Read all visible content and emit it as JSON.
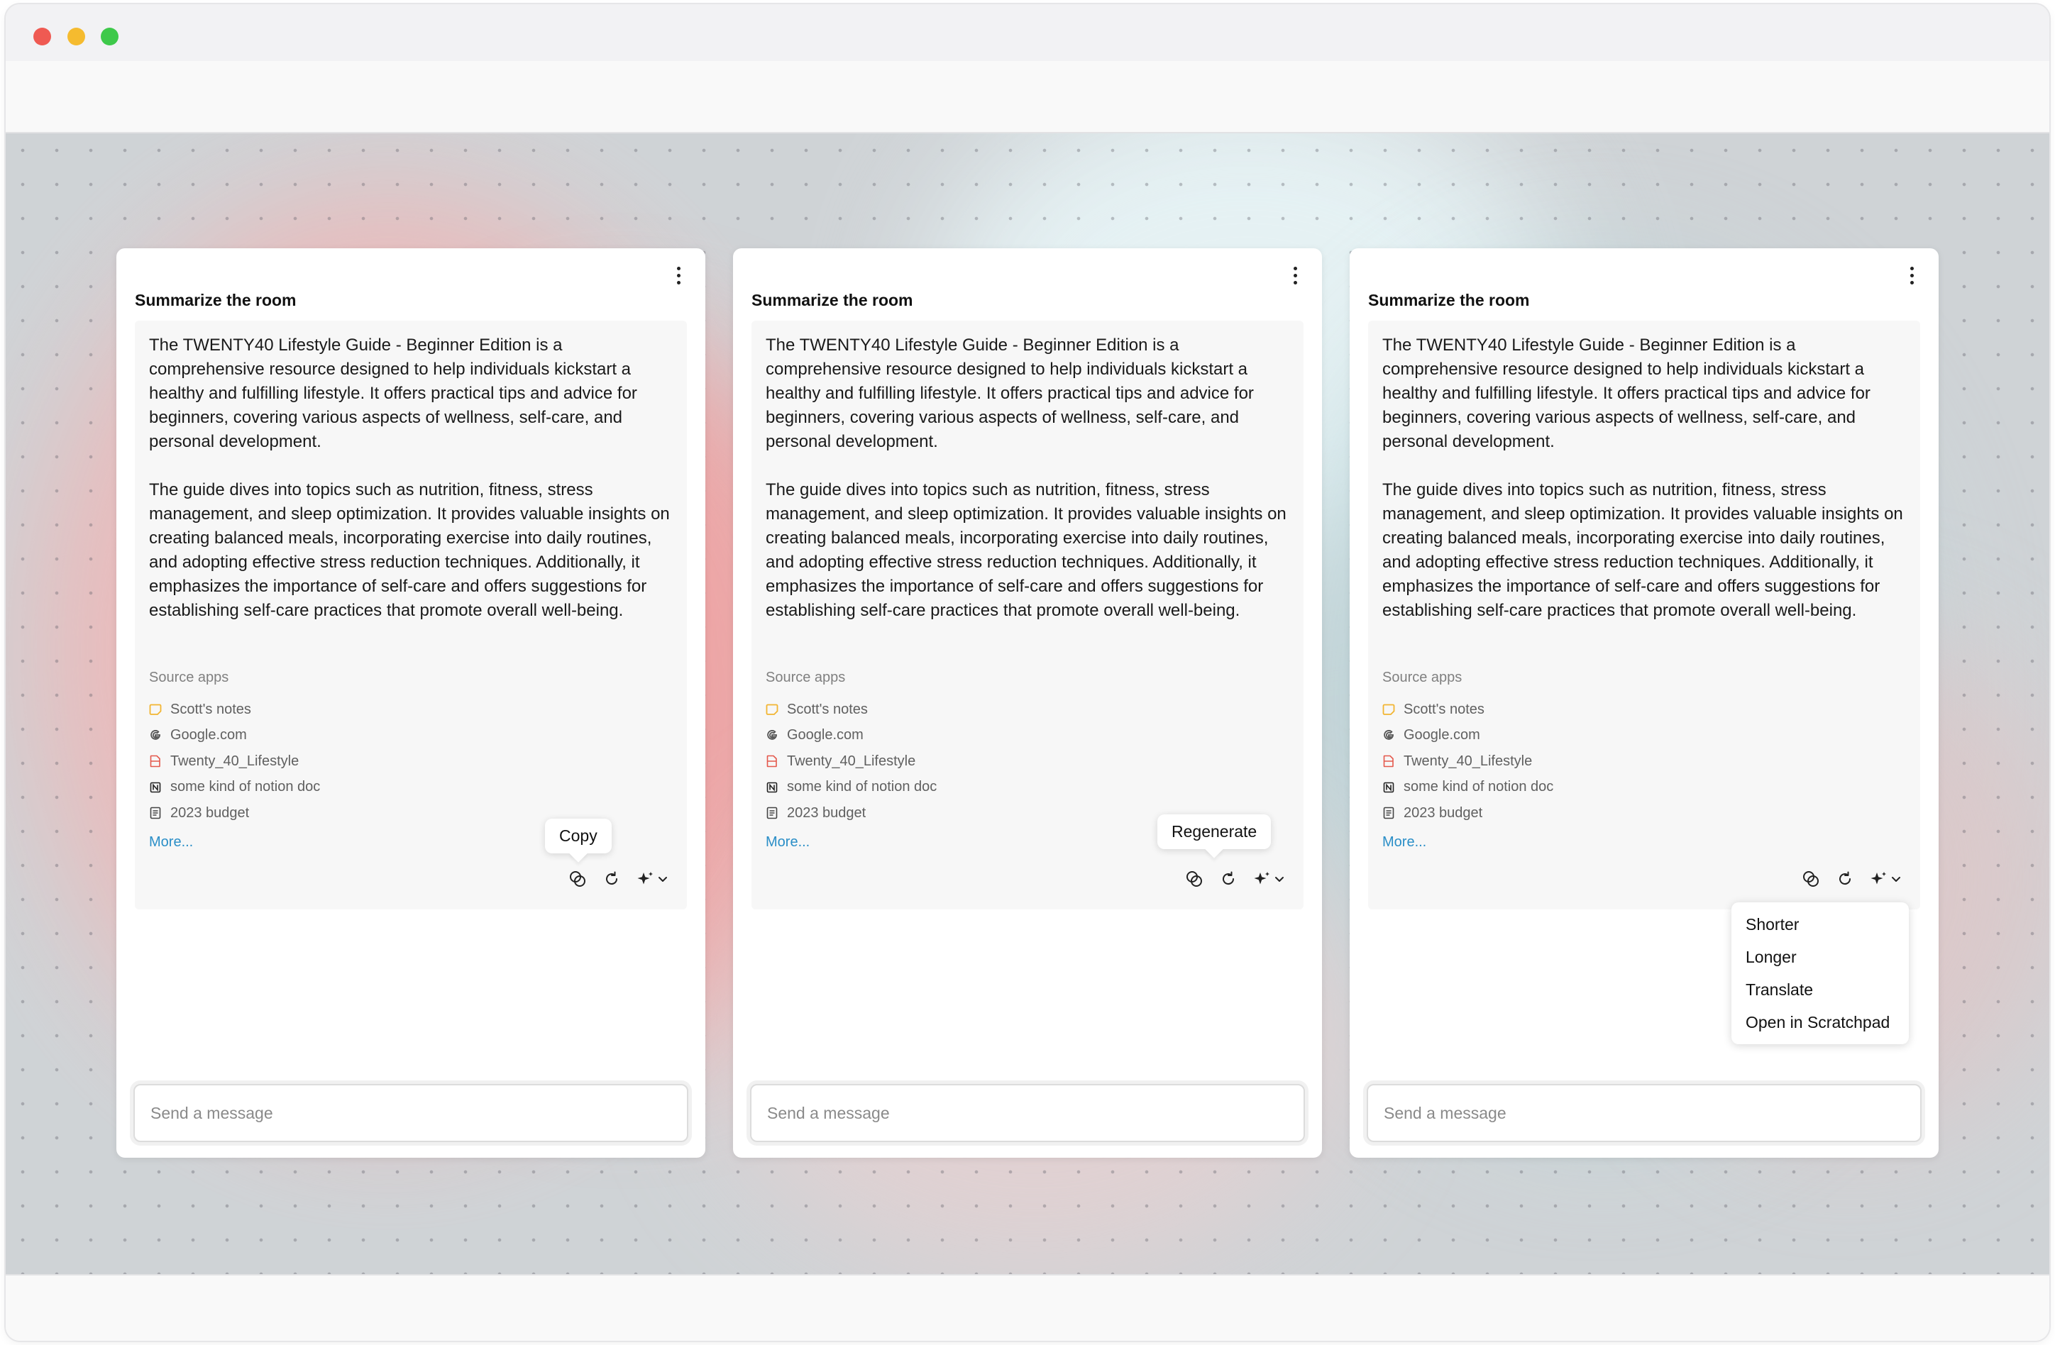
{
  "window": {
    "controls": [
      "close",
      "minimize",
      "zoom"
    ]
  },
  "cards": [
    {
      "title": "Summarize the room",
      "paragraph1": "The TWENTY40 Lifestyle Guide - Beginner Edition is a comprehensive resource designed to help individuals kickstart a healthy and fulfilling lifestyle. It offers practical tips and advice for beginners, covering various aspects of wellness, self-care, and personal development.",
      "paragraph2": "The guide dives into topics such as nutrition, fitness, stress management, and sleep optimization. It provides valuable insights on creating balanced meals, incorporating exercise into daily routines, and adopting effective stress reduction techniques. Additionally, it emphasizes the importance of self-care and offers suggestions for establishing self-care practices that promote overall well-being.",
      "source_label": "Source apps",
      "sources": [
        {
          "label": "Scott's notes",
          "icon": "notes-icon"
        },
        {
          "label": "Google.com",
          "icon": "google-icon"
        },
        {
          "label": "Twenty_40_Lifestyle",
          "icon": "pdf-icon"
        },
        {
          "label": "some kind of notion doc",
          "icon": "notion-icon"
        },
        {
          "label": "2023 budget",
          "icon": "document-icon"
        }
      ],
      "more_label": "More...",
      "tooltip": "Copy",
      "input_placeholder": "Send a message"
    },
    {
      "title": "Summarize the room",
      "paragraph1": "The TWENTY40 Lifestyle Guide - Beginner Edition is a comprehensive resource designed to help individuals kickstart a healthy and fulfilling lifestyle. It offers practical tips and advice for beginners, covering various aspects of wellness, self-care, and personal development.",
      "paragraph2": "The guide dives into topics such as nutrition, fitness, stress management, and sleep optimization. It provides valuable insights on creating balanced meals, incorporating exercise into daily routines, and adopting effective stress reduction techniques. Additionally, it emphasizes the importance of self-care and offers suggestions for establishing self-care practices that promote overall well-being.",
      "source_label": "Source apps",
      "sources": [
        {
          "label": "Scott's notes",
          "icon": "notes-icon"
        },
        {
          "label": "Google.com",
          "icon": "google-icon"
        },
        {
          "label": "Twenty_40_Lifestyle",
          "icon": "pdf-icon"
        },
        {
          "label": "some kind of notion doc",
          "icon": "notion-icon"
        },
        {
          "label": "2023 budget",
          "icon": "document-icon"
        }
      ],
      "more_label": "More...",
      "tooltip": "Regenerate",
      "input_placeholder": "Send a message"
    },
    {
      "title": "Summarize the room",
      "paragraph1": "The TWENTY40 Lifestyle Guide - Beginner Edition is a comprehensive resource designed to help individuals kickstart a healthy and fulfilling lifestyle. It offers practical tips and advice for beginners, covering various aspects of wellness, self-care, and personal development.",
      "paragraph2": "The guide dives into topics such as nutrition, fitness, stress management, and sleep optimization. It provides valuable insights on creating balanced meals, incorporating exercise into daily routines, and adopting effective stress reduction techniques. Additionally, it emphasizes the importance of self-care and offers suggestions for establishing self-care practices that promote overall well-being.",
      "source_label": "Source apps",
      "sources": [
        {
          "label": "Scott's notes",
          "icon": "notes-icon"
        },
        {
          "label": "Google.com",
          "icon": "google-icon"
        },
        {
          "label": "Twenty_40_Lifestyle",
          "icon": "pdf-icon"
        },
        {
          "label": "some kind of notion doc",
          "icon": "notion-icon"
        },
        {
          "label": "2023 budget",
          "icon": "document-icon"
        }
      ],
      "more_label": "More...",
      "menu": [
        "Shorter",
        "Longer",
        "Translate",
        "Open in Scratchpad"
      ],
      "input_placeholder": "Send a message"
    }
  ],
  "colors": {
    "link": "#2a8ec7",
    "notes_icon": "#f2b531",
    "pdf_icon": "#e4584c"
  }
}
